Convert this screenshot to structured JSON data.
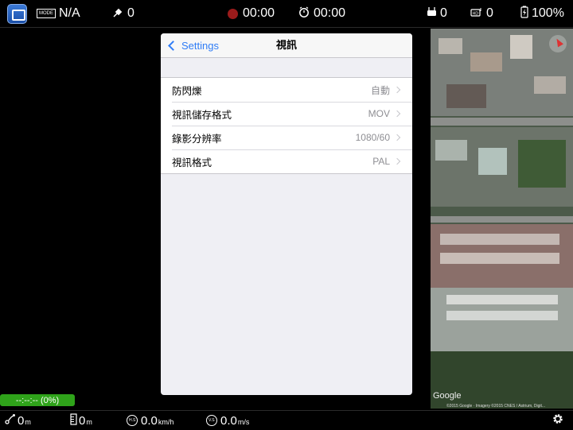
{
  "topbar": {
    "mode_badge": "MODE",
    "mode_value": "N/A",
    "satellite_count": "0",
    "record_time": "00:00",
    "timer": "00:00",
    "controller_signal": "0",
    "hd_signal": "0",
    "battery": "100%"
  },
  "panel": {
    "back_label": "Settings",
    "title": "視訊",
    "rows": [
      {
        "label": "防閃爍",
        "value": "自動"
      },
      {
        "label": "視訊儲存格式",
        "value": "MOV"
      },
      {
        "label": "錄影分辨率",
        "value": "1080/60"
      },
      {
        "label": "視訊格式",
        "value": "PAL"
      }
    ]
  },
  "battery_bar": {
    "text": "--:--:-- (0%)"
  },
  "map": {
    "logo": "Google",
    "copyright": "©2015 Google · Imagery ©2015 CNES / Astrium, Digit..."
  },
  "bottombar": {
    "distance_value": "0",
    "distance_unit": "m",
    "height_value": "0",
    "height_unit": "m",
    "hs_value": "0.0",
    "hs_unit": "km/h",
    "hs_badge": "H.S",
    "vs_value": "0.0",
    "vs_unit": "m/s",
    "vs_badge": "V.S"
  }
}
